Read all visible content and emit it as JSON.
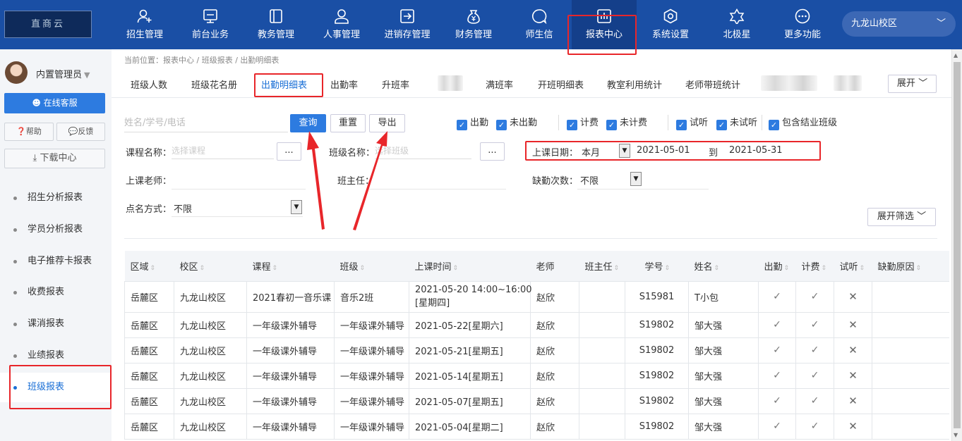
{
  "logo": {
    "text": "直商云"
  },
  "nav": {
    "items": [
      {
        "label": "招生管理",
        "icon": "add-user-icon"
      },
      {
        "label": "前台业务",
        "icon": "monitor-icon"
      },
      {
        "label": "教务管理",
        "icon": "book-icon"
      },
      {
        "label": "人事管理",
        "icon": "person-icon"
      },
      {
        "label": "进销存管理",
        "icon": "inventory-icon"
      },
      {
        "label": "财务管理",
        "icon": "money-bag-icon"
      },
      {
        "label": "师生信",
        "icon": "chat-icon"
      },
      {
        "label": "报表中心",
        "icon": "report-icon"
      },
      {
        "label": "系统设置",
        "icon": "settings-icon"
      },
      {
        "label": "北极星",
        "icon": "star-icon"
      },
      {
        "label": "更多功能",
        "icon": "more-icon"
      }
    ],
    "active_index": 7,
    "campus": "九龙山校区"
  },
  "sidebar": {
    "user": "内置管理员",
    "service": "在线客服",
    "help": "帮助",
    "feedback": "反馈",
    "download": "下载中心",
    "items": [
      {
        "label": "招生分析报表"
      },
      {
        "label": "学员分析报表"
      },
      {
        "label": "电子推荐卡报表"
      },
      {
        "label": "收费报表"
      },
      {
        "label": "课消报表"
      },
      {
        "label": "业绩报表"
      },
      {
        "label": "班级报表"
      }
    ]
  },
  "breadcrumb": "当前位置：报表中心 / 班级报表 / 出勤明细表",
  "tabs": [
    "班级人数",
    "班级花名册",
    "出勤明细表",
    "出勤率",
    "升班率",
    "满班率",
    "开班明细表",
    "教室利用统计",
    "老师带班统计"
  ],
  "expand_btn": "展开",
  "filters": {
    "search_placeholder": "姓名/学号/电话",
    "query": "查询",
    "reset": "重置",
    "export": "导出",
    "checks": [
      "出勤",
      "未出勤",
      "计费",
      "未计费",
      "试听",
      "未试听",
      "包含结业班级"
    ],
    "course_label": "课程名称：",
    "course_placeholder": "选择课程",
    "class_label": "班级名称：",
    "class_placeholder": "选择班级",
    "dots": "...",
    "date_label": "上课日期：",
    "date_range": "本月",
    "date_from": "2021-05-01",
    "date_to_label": "到",
    "date_to": "2021-05-31",
    "teacher_label": "上课老师：",
    "headteacher_label": "班主任：",
    "absence_label": "缺勤次数：",
    "absence_value": "不限",
    "rollcall_label": "点名方式：",
    "rollcall_value": "不限",
    "expand_filter": "展开筛选"
  },
  "table": {
    "headers": [
      "区域",
      "校区",
      "课程",
      "班级",
      "上课时间",
      "老师",
      "班主任",
      "学号",
      "姓名",
      "出勤",
      "计费",
      "试听",
      "缺勤原因"
    ],
    "rows": [
      {
        "region": "岳麓区",
        "campus": "九龙山校区",
        "course": "2021春初一音乐课",
        "class": "音乐2班",
        "time": "2021-05-20 14:00~16:00",
        "time2": "[星期四]",
        "teacher": "赵欣",
        "head": "",
        "sid": "S15981",
        "name": "T小包",
        "attend": "✓",
        "bill": "✓",
        "trial": "✕",
        "reason": ""
      },
      {
        "region": "岳麓区",
        "campus": "九龙山校区",
        "course": "一年级课外辅导",
        "class": "一年级课外辅导",
        "time": "2021-05-22[星期六]",
        "time2": "",
        "teacher": "赵欣",
        "head": "",
        "sid": "S19802",
        "name": "邹大强",
        "attend": "✓",
        "bill": "✓",
        "trial": "✕",
        "reason": ""
      },
      {
        "region": "岳麓区",
        "campus": "九龙山校区",
        "course": "一年级课外辅导",
        "class": "一年级课外辅导",
        "time": "2021-05-21[星期五]",
        "time2": "",
        "teacher": "赵欣",
        "head": "",
        "sid": "S19802",
        "name": "邹大强",
        "attend": "✓",
        "bill": "✓",
        "trial": "✕",
        "reason": ""
      },
      {
        "region": "岳麓区",
        "campus": "九龙山校区",
        "course": "一年级课外辅导",
        "class": "一年级课外辅导",
        "time": "2021-05-14[星期五]",
        "time2": "",
        "teacher": "赵欣",
        "head": "",
        "sid": "S19802",
        "name": "邹大强",
        "attend": "✓",
        "bill": "✓",
        "trial": "✕",
        "reason": ""
      },
      {
        "region": "岳麓区",
        "campus": "九龙山校区",
        "course": "一年级课外辅导",
        "class": "一年级课外辅导",
        "time": "2021-05-07[星期五]",
        "time2": "",
        "teacher": "赵欣",
        "head": "",
        "sid": "S19802",
        "name": "邹大强",
        "attend": "✓",
        "bill": "✓",
        "trial": "✕",
        "reason": ""
      },
      {
        "region": "岳麓区",
        "campus": "九龙山校区",
        "course": "一年级课外辅导",
        "class": "一年级课外辅导",
        "time": "2021-05-04[星期二]",
        "time2": "",
        "teacher": "赵欣",
        "head": "",
        "sid": "S19802",
        "name": "邹大强",
        "attend": "✓",
        "bill": "✓",
        "trial": "✕",
        "reason": ""
      }
    ]
  },
  "colors": {
    "topbar": "#1a4fa5",
    "accent": "#2d7be0",
    "highlight": "#e8262a"
  }
}
